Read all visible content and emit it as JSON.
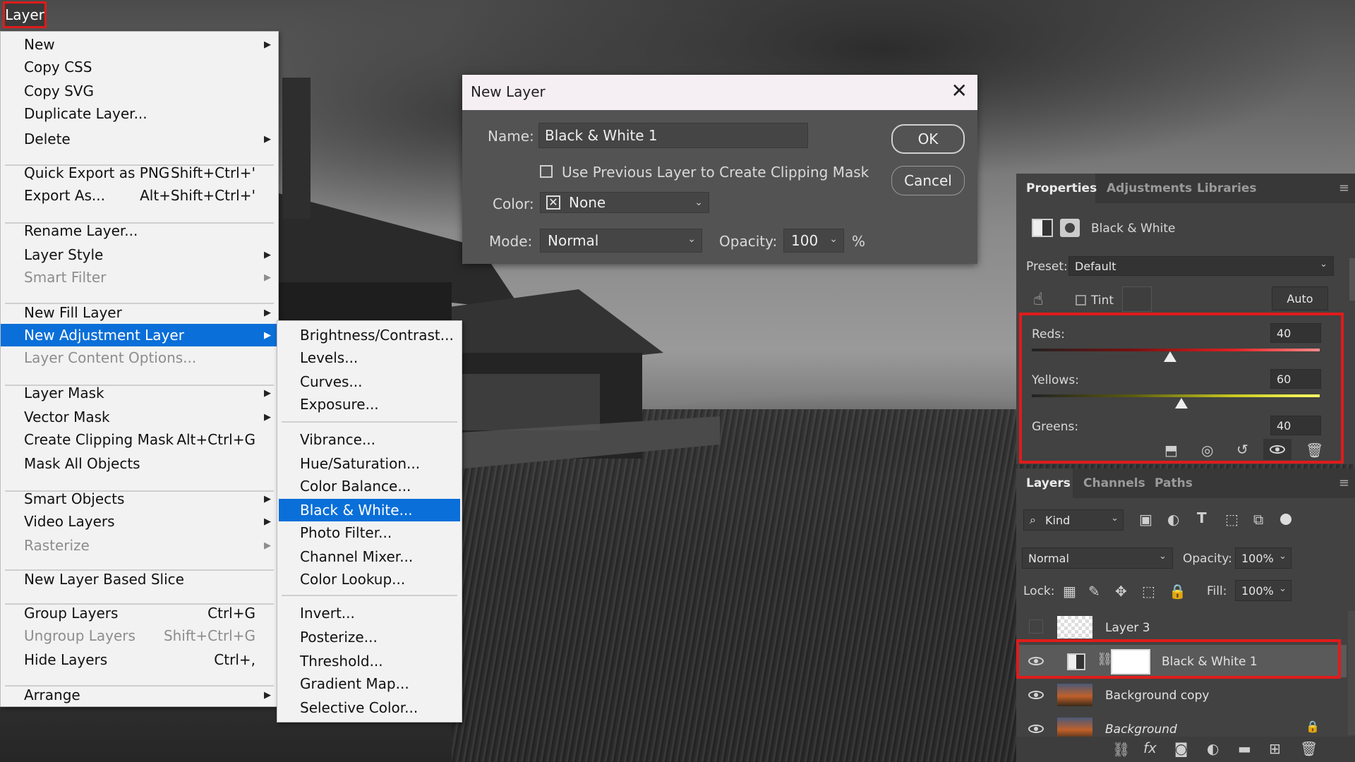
{
  "menubar": {
    "title": "Layer"
  },
  "layer_menu": {
    "items": [
      {
        "label": "New",
        "shortcut": "",
        "submenu": true,
        "disabled": false
      },
      {
        "label": "Copy CSS",
        "shortcut": "",
        "submenu": false,
        "disabled": false
      },
      {
        "label": "Copy SVG",
        "shortcut": "",
        "submenu": false,
        "disabled": false
      },
      {
        "label": "Duplicate Layer...",
        "shortcut": "",
        "submenu": false,
        "disabled": false
      },
      {
        "label": "Delete",
        "shortcut": "",
        "submenu": true,
        "disabled": false
      },
      {
        "label": "Quick Export as PNG",
        "shortcut": "Shift+Ctrl+'",
        "submenu": false,
        "disabled": false
      },
      {
        "label": "Export As...",
        "shortcut": "Alt+Shift+Ctrl+'",
        "submenu": false,
        "disabled": false
      },
      {
        "label": "Rename Layer...",
        "shortcut": "",
        "submenu": false,
        "disabled": false
      },
      {
        "label": "Layer Style",
        "shortcut": "",
        "submenu": true,
        "disabled": false
      },
      {
        "label": "Smart Filter",
        "shortcut": "",
        "submenu": true,
        "disabled": true
      },
      {
        "label": "New Fill Layer",
        "shortcut": "",
        "submenu": true,
        "disabled": false
      },
      {
        "label": "New Adjustment Layer",
        "shortcut": "",
        "submenu": true,
        "disabled": false,
        "highlighted": true
      },
      {
        "label": "Layer Content Options...",
        "shortcut": "",
        "submenu": false,
        "disabled": true
      },
      {
        "label": "Layer Mask",
        "shortcut": "",
        "submenu": true,
        "disabled": false
      },
      {
        "label": "Vector Mask",
        "shortcut": "",
        "submenu": true,
        "disabled": false
      },
      {
        "label": "Create Clipping Mask",
        "shortcut": "Alt+Ctrl+G",
        "submenu": false,
        "disabled": false
      },
      {
        "label": "Mask All Objects",
        "shortcut": "",
        "submenu": false,
        "disabled": false
      },
      {
        "label": "Smart Objects",
        "shortcut": "",
        "submenu": true,
        "disabled": false
      },
      {
        "label": "Video Layers",
        "shortcut": "",
        "submenu": true,
        "disabled": false
      },
      {
        "label": "Rasterize",
        "shortcut": "",
        "submenu": true,
        "disabled": true
      },
      {
        "label": "New Layer Based Slice",
        "shortcut": "",
        "submenu": false,
        "disabled": false
      },
      {
        "label": "Group Layers",
        "shortcut": "Ctrl+G",
        "submenu": false,
        "disabled": false
      },
      {
        "label": "Ungroup Layers",
        "shortcut": "Shift+Ctrl+G",
        "submenu": false,
        "disabled": true
      },
      {
        "label": "Hide Layers",
        "shortcut": "Ctrl+,",
        "submenu": false,
        "disabled": false
      },
      {
        "label": "Arrange",
        "shortcut": "",
        "submenu": true,
        "disabled": false
      }
    ]
  },
  "adjustment_submenu": {
    "items": [
      {
        "label": "Brightness/Contrast..."
      },
      {
        "label": "Levels..."
      },
      {
        "label": "Curves..."
      },
      {
        "label": "Exposure..."
      },
      {
        "label": "Vibrance..."
      },
      {
        "label": "Hue/Saturation..."
      },
      {
        "label": "Color Balance..."
      },
      {
        "label": "Black & White...",
        "highlighted": true
      },
      {
        "label": "Photo Filter..."
      },
      {
        "label": "Channel Mixer..."
      },
      {
        "label": "Color Lookup..."
      },
      {
        "label": "Invert..."
      },
      {
        "label": "Posterize..."
      },
      {
        "label": "Threshold..."
      },
      {
        "label": "Gradient Map..."
      },
      {
        "label": "Selective Color..."
      }
    ]
  },
  "dialog": {
    "title": "New Layer",
    "name_label": "Name:",
    "name_value": "Black & White 1",
    "clip_label": "Use Previous Layer to Create Clipping Mask",
    "color_label": "Color:",
    "color_value": "None",
    "mode_label": "Mode:",
    "mode_value": "Normal",
    "opacity_label": "Opacity:",
    "opacity_value": "100",
    "opacity_unit": "%",
    "ok": "OK",
    "cancel": "Cancel"
  },
  "properties": {
    "tabs": [
      "Properties",
      "Adjustments",
      "Libraries"
    ],
    "title": "Black & White",
    "preset_label": "Preset:",
    "preset_value": "Default",
    "tint_label": "Tint",
    "auto": "Auto",
    "sliders": [
      {
        "label": "Reds:",
        "value": "40",
        "pos": 0.48
      },
      {
        "label": "Yellows:",
        "value": "60",
        "pos": 0.52
      },
      {
        "label": "Greens:",
        "value": "40"
      }
    ]
  },
  "layers": {
    "tabs": [
      "Layers",
      "Channels",
      "Paths"
    ],
    "kind": "Kind",
    "blend": "Normal",
    "opacity_label": "Opacity:",
    "opacity_value": "100%",
    "lock_label": "Lock:",
    "fill_label": "Fill:",
    "fill_value": "100%",
    "rows": [
      {
        "name": "Layer 3"
      },
      {
        "name": "Black & White 1"
      },
      {
        "name": "Background copy"
      },
      {
        "name": "Background"
      }
    ]
  },
  "colors": {
    "accent": "#0a6fd8",
    "highlight_box": "#e01b1b"
  }
}
